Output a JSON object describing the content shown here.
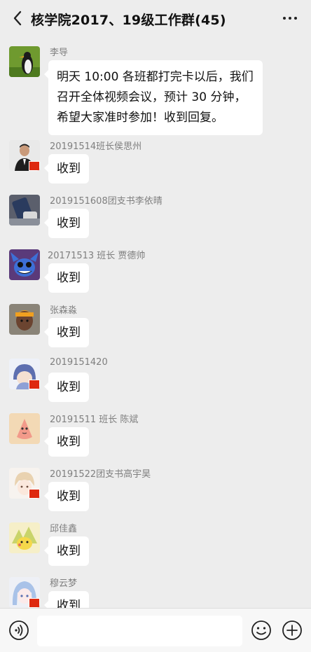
{
  "header": {
    "title": "核学院2017、19级工作群(45)"
  },
  "messages": [
    {
      "sender": "李导",
      "text": "明天 10:00 各班都打完卡以后，我们召开全体视频会议，预计 30 分钟，希望大家准时参加！收到回复。"
    },
    {
      "sender": "20191514班长侯思州",
      "text": "收到"
    },
    {
      "sender": "2019151608团支书李依晴",
      "text": "收到"
    },
    {
      "sender": "20171513 班长 贾德帅",
      "text": "收到"
    },
    {
      "sender": "张森淼",
      "text": "收到"
    },
    {
      "sender": "2019151420",
      "text": "收到"
    },
    {
      "sender": "20191511 班长 陈斌",
      "text": "收到"
    },
    {
      "sender": "20191522团支书高宇昊",
      "text": "收到"
    },
    {
      "sender": "邱佳鑫",
      "text": "收到"
    },
    {
      "sender": "穆云梦",
      "text": "收到"
    }
  ],
  "icons": {
    "back": "chevron-left-icon",
    "more": "more-dots-icon",
    "voice": "voice-icon",
    "emoji": "emoji-icon",
    "plus": "plus-icon"
  }
}
